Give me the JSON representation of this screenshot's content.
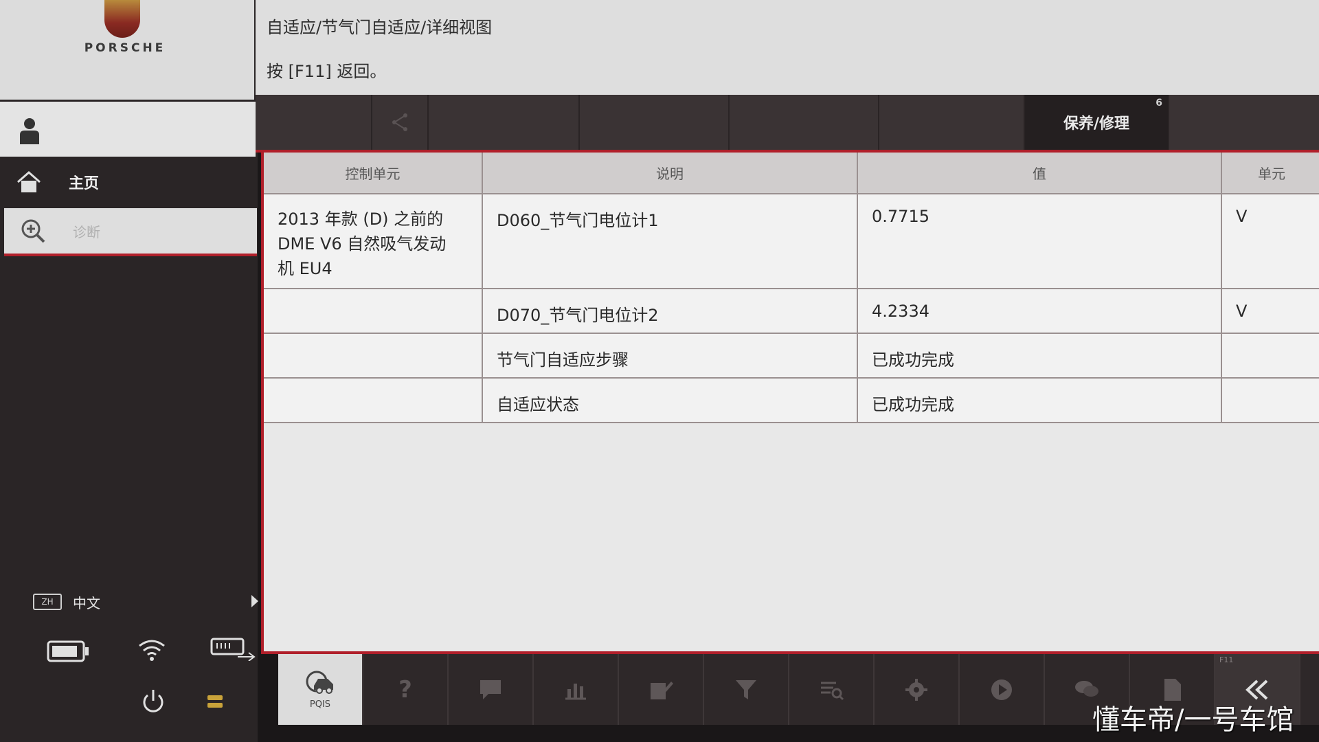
{
  "brand": {
    "name": "PORSCHE"
  },
  "sidebar": {
    "home_label": "主页",
    "diagnosis_label": "诊断",
    "language_code": "ZH",
    "language_label": "中文"
  },
  "header": {
    "breadcrumb": "自适应/节气门自适应/详细视图",
    "hint": "按 [F11] 返回。"
  },
  "tabs": [
    {
      "label": ""
    },
    {
      "label": ""
    },
    {
      "label": ""
    },
    {
      "label": ""
    },
    {
      "label": ""
    },
    {
      "label": ""
    },
    {
      "label": "保养/修理",
      "badge": "6"
    },
    {
      "label": ""
    }
  ],
  "table": {
    "headers": [
      "控制单元",
      "说明",
      "值",
      "单元"
    ],
    "ecu_lines": [
      "2013 年款 (D) 之前的",
      "DME V6 自然吸气发动",
      "机 EU4"
    ],
    "rows": [
      {
        "description": "D060_节气门电位计1",
        "value": "0.7715",
        "unit": "V"
      },
      {
        "description": "D070_节气门电位计2",
        "value": "4.2334",
        "unit": "V"
      },
      {
        "description": "节气门自适应步骤",
        "value": "已成功完成",
        "unit": ""
      },
      {
        "description": "自适应状态",
        "value": "已成功完成",
        "unit": ""
      }
    ]
  },
  "toolbar": {
    "pqis_label": "PQIS",
    "back_fkey": "F11",
    "help_glyph": "?"
  },
  "watermark": "懂车帝/一号车馆",
  "colors": {
    "accent_red": "#b01f2a",
    "sidebar_dark": "#2a2526",
    "panel_light": "#e8e8e8"
  }
}
